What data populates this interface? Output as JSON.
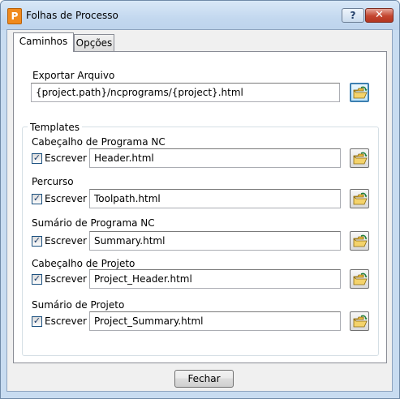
{
  "window": {
    "title": "Folhas de Processo",
    "app_icon_letter": "P",
    "help_label": "?",
    "close_label": "✕"
  },
  "tabs": [
    {
      "label": "Caminhos",
      "active": true
    },
    {
      "label": "Opções",
      "active": false
    }
  ],
  "export": {
    "label": "Exportar Arquivo",
    "value": "{project.path}/ncprograms/{project}.html"
  },
  "templates": {
    "title": "Templates",
    "rows": [
      {
        "label": "Cabeçalho de Programa NC",
        "checkbox_label": "Escrever",
        "checked": true,
        "value": "Header.html"
      },
      {
        "label": "Percurso",
        "checkbox_label": "Escrever",
        "checked": true,
        "value": "Toolpath.html"
      },
      {
        "label": "Sumário de Programa NC",
        "checkbox_label": "Escrever",
        "checked": true,
        "value": "Summary.html"
      },
      {
        "label": "Cabeçalho de Projeto",
        "checkbox_label": "Escrever",
        "checked": true,
        "value": "Project_Header.html"
      },
      {
        "label": "Sumário de Projeto",
        "checkbox_label": "Escrever",
        "checked": true,
        "value": "Project_Summary.html"
      }
    ]
  },
  "footer": {
    "close_button": "Fechar"
  },
  "icons": {
    "browse": "open-folder-icon",
    "checkmark": "✓"
  }
}
